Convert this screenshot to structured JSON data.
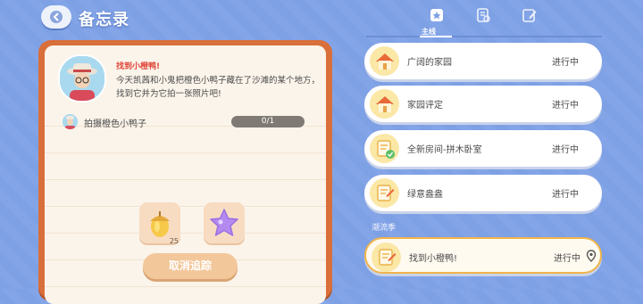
{
  "header": {
    "title": "备忘录",
    "back_icon": "chevron-left-icon"
  },
  "quest_detail": {
    "title": "找到小橙鸭!",
    "description": "今天凯茜和小鬼把橙色小鸭子藏在了沙滩的某个地方，找到它并为它拍一张照片吧!",
    "task": {
      "label": "拍摄橙色小鸭子",
      "progress_text": "0/1",
      "progress": 0
    },
    "rewards": [
      {
        "icon": "acorn-icon",
        "count": "25"
      },
      {
        "icon": "star-icon",
        "count": ""
      }
    ],
    "cancel_label": "取消追踪"
  },
  "tabs": {
    "items": [
      {
        "icon": "main-quest-icon"
      },
      {
        "icon": "document-icon"
      },
      {
        "icon": "pen-icon"
      }
    ],
    "active_label": "主线"
  },
  "quest_list": {
    "items": [
      {
        "name": "广阔的家园",
        "status": "进行中",
        "icon": "house-icon"
      },
      {
        "name": "家园评定",
        "status": "进行中",
        "icon": "house-icon"
      },
      {
        "name": "全新房间-拼木卧室",
        "status": "进行中",
        "icon": "quest-note-icon"
      },
      {
        "name": "绿意盎盎",
        "status": "进行中",
        "icon": "quest-note-icon"
      }
    ],
    "section_label": "潮流季",
    "seasonal": [
      {
        "name": "找到小橙鸭!",
        "status": "进行中",
        "icon": "quest-note-icon",
        "tracked": true
      }
    ]
  },
  "colors": {
    "accent": "#f0b44a",
    "panel_border": "#d96f3a",
    "background": "#7ea0e4"
  }
}
